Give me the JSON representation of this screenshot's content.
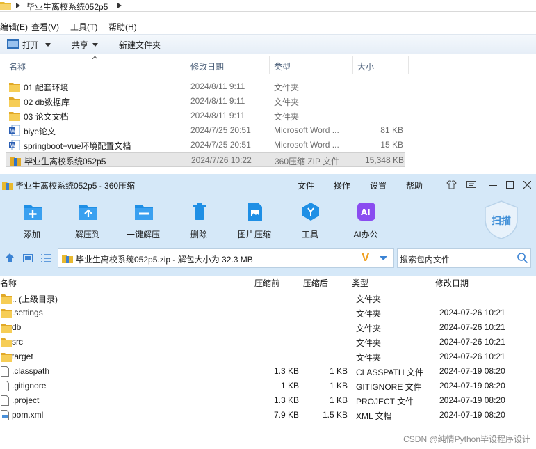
{
  "explorer": {
    "breadcrumb": "毕业生离校系统052p5",
    "menu": [
      "编辑(E)",
      "查看(V)",
      "工具(T)",
      "帮助(H)"
    ],
    "toolbar": {
      "open": "打开",
      "share": "共享",
      "new_folder": "新建文件夹"
    },
    "columns": {
      "name": "名称",
      "date": "修改日期",
      "type": "类型",
      "size": "大小"
    },
    "files": [
      {
        "icon": "folder-icon",
        "name": "01 配套环境",
        "date": "2024/8/11 9:11",
        "type": "文件夹",
        "size": ""
      },
      {
        "icon": "folder-icon",
        "name": "02 db数据库",
        "date": "2024/8/11 9:11",
        "type": "文件夹",
        "size": ""
      },
      {
        "icon": "folder-icon",
        "name": "03 论文文档",
        "date": "2024/8/11 9:11",
        "type": "文件夹",
        "size": ""
      },
      {
        "icon": "word-doc-icon",
        "name": "biye论文",
        "date": "2024/7/25 20:51",
        "type": "Microsoft Word ...",
        "size": "81 KB"
      },
      {
        "icon": "word-doc-icon",
        "name": "springboot+vue环境配置文档",
        "date": "2024/7/25 20:51",
        "type": "Microsoft Word ...",
        "size": "15 KB"
      },
      {
        "icon": "zip-icon",
        "name": "毕业生离校系统052p5",
        "date": "2024/7/26 10:22",
        "type": "360压缩 ZIP 文件",
        "size": "15,348 KB"
      }
    ]
  },
  "zip": {
    "title": "毕业生离校系统052p5 - 360压缩",
    "menu": [
      "文件",
      "操作",
      "设置",
      "帮助"
    ],
    "tools": [
      {
        "icon": "add-icon",
        "label": "添加",
        "color": "#1f8fe5"
      },
      {
        "icon": "extract-to-icon",
        "label": "解压到",
        "color": "#1f8fe5"
      },
      {
        "icon": "one-click-extract-icon",
        "label": "一键解压",
        "color": "#1f8fe5"
      },
      {
        "icon": "delete-icon",
        "label": "删除",
        "color": "#1f8fe5"
      },
      {
        "icon": "image-compress-icon",
        "label": "图片压缩",
        "color": "#1f8fe5"
      },
      {
        "icon": "tools-icon",
        "label": "工具",
        "color": "#1f8fe5"
      },
      {
        "icon": "ai-office-icon",
        "label": "AI办公",
        "color": "#8a4cf0"
      }
    ],
    "scan_label": "扫描",
    "path_text": "毕业生离校系统052p5.zip - 解包大小为 32.3 MB",
    "search_placeholder": "搜索包内文件",
    "columns": {
      "name": "名称",
      "before": "压缩前",
      "after": "压缩后",
      "type": "类型",
      "date": "修改日期"
    },
    "rows": [
      {
        "icon": "folder-icon",
        "name": ".. (上级目录)",
        "before": "",
        "after": "",
        "type": "文件夹",
        "date": ""
      },
      {
        "icon": "folder-icon",
        "name": ".settings",
        "before": "",
        "after": "",
        "type": "文件夹",
        "date": "2024-07-26 10:21"
      },
      {
        "icon": "folder-icon",
        "name": "db",
        "before": "",
        "after": "",
        "type": "文件夹",
        "date": "2024-07-26 10:21"
      },
      {
        "icon": "folder-icon",
        "name": "src",
        "before": "",
        "after": "",
        "type": "文件夹",
        "date": "2024-07-26 10:21"
      },
      {
        "icon": "folder-icon",
        "name": "target",
        "before": "",
        "after": "",
        "type": "文件夹",
        "date": "2024-07-26 10:21"
      },
      {
        "icon": "file-icon",
        "name": ".classpath",
        "before": "1.3 KB",
        "after": "1 KB",
        "type": "CLASSPATH 文件",
        "date": "2024-07-19 08:20"
      },
      {
        "icon": "file-icon",
        "name": ".gitignore",
        "before": "1 KB",
        "after": "1 KB",
        "type": "GITIGNORE 文件",
        "date": "2024-07-19 08:20"
      },
      {
        "icon": "file-icon",
        "name": ".project",
        "before": "1.3 KB",
        "after": "1 KB",
        "type": "PROJECT 文件",
        "date": "2024-07-19 08:20"
      },
      {
        "icon": "xml-file-icon",
        "name": "pom.xml",
        "before": "7.9 KB",
        "after": "1.5 KB",
        "type": "XML 文档",
        "date": "2024-07-19 08:20"
      }
    ]
  },
  "watermark": "CSDN @纯情Python毕设程序设计"
}
